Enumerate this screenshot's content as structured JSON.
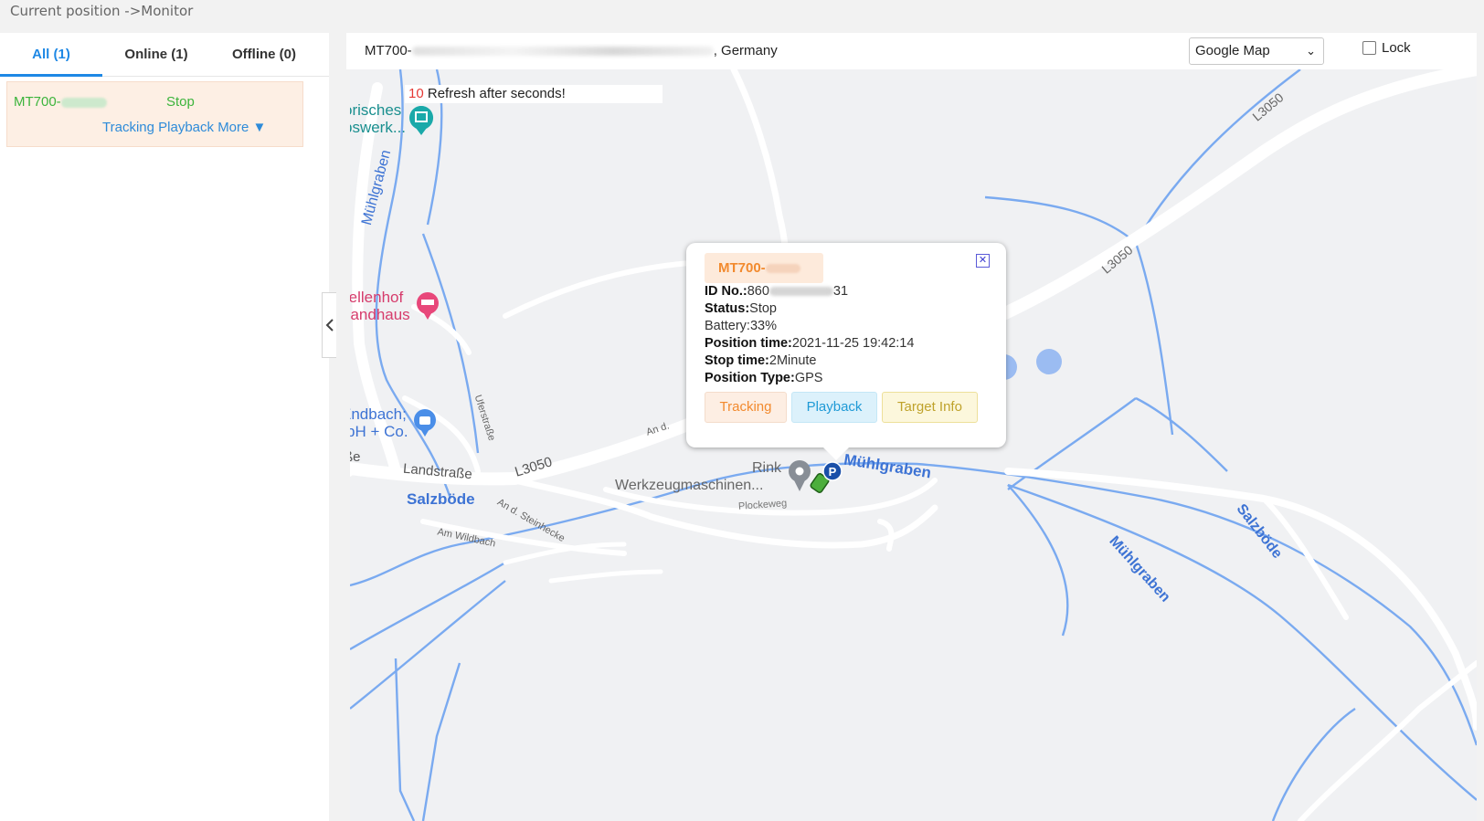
{
  "breadcrumb": "Current position ->Monitor",
  "tabs": [
    {
      "label": "All (1)",
      "active": true
    },
    {
      "label": "Online (1)",
      "active": false
    },
    {
      "label": "Offline (0)",
      "active": false
    }
  ],
  "device": {
    "name": "MT700-",
    "status": "Stop",
    "links": {
      "tracking": "Tracking",
      "playback": "Playback",
      "more": "More ▼"
    }
  },
  "map_header": {
    "title_prefix": "MT700-",
    "title_suffix": ", Germany",
    "map_type": "Google Map",
    "lock_label": "Lock"
  },
  "refresh": {
    "seconds": "10",
    "text": "Refresh after seconds!"
  },
  "map_labels": {
    "poi1_line1": "orisches",
    "poi1_line2": "bswerk...",
    "muhlgraben_left": "Mühlgraben",
    "poi2_line1": "rellenhof",
    "poi2_line2": "Landhaus",
    "poi3_line1": "Endbach;",
    "poi3_line2": "bH + Co.",
    "be": "ße",
    "landstrasse": "Landstraße",
    "l3050_a": "L3050",
    "l3050_b": "L3050",
    "l3050_c": "L3050",
    "salzbode_left": "Salzböde",
    "ufer": "Uferstraße",
    "an_d_steinhecke": "An d. Steinhecke",
    "am_wildbach": "Am Wildbach",
    "an_d": "An d.",
    "rink_line1": "Rink",
    "rink_line2": "Werkzeugmaschinen...",
    "plockeweg": "Plockeweg",
    "muhlgraben_center": "Mühlgraben",
    "muhlgraben_right": "Mühlgraben",
    "salzbode_right": "Salzböde"
  },
  "popup": {
    "name": "MT700-",
    "id_label": "ID No.:",
    "id_start": "860",
    "id_end": "31",
    "status_label": "Status:",
    "status_value": "Stop",
    "battery": "Battery:33%",
    "position_time_label": "Position time:",
    "position_time_value": "2021-11-25 19:42:14",
    "stop_time_label": "Stop time:",
    "stop_time_value": "2Minute",
    "position_type_label": "Position Type:",
    "position_type_value": "GPS",
    "buttons": {
      "tracking": "Tracking",
      "playback": "Playback",
      "target": "Target Info"
    }
  },
  "colors": {
    "accent": "#1e88e5",
    "online": "#3cb43c",
    "river": "#6fa4ee",
    "road": "#ffffff",
    "map_bg": "#f0f1f3"
  }
}
